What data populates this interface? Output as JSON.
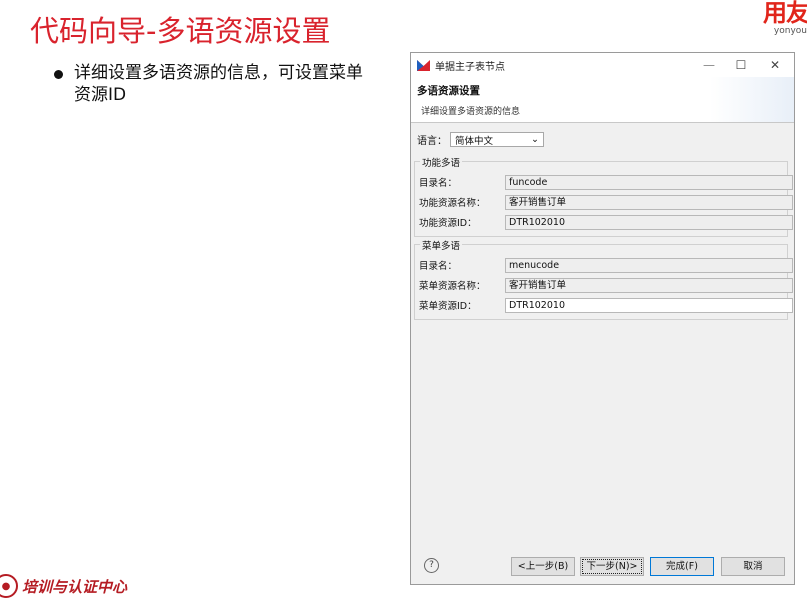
{
  "slide": {
    "title": "代码向导-多语资源设置",
    "bullet": "详细设置多语资源的信息，可设置菜单资源ID",
    "brand_main": "用友",
    "brand_sub": "yonyou",
    "footer_text": "培训与认证中心"
  },
  "dialog": {
    "window_title": "单据主子表节点",
    "banner_title": "多语资源设置",
    "banner_desc": "详细设置多语资源的信息",
    "language": {
      "label": "语言：",
      "selected": "简体中文"
    },
    "function_group": {
      "label": "功能多语",
      "fields": [
        {
          "label": "目录名：",
          "value": "funcode"
        },
        {
          "label": "功能资源名称：",
          "value": "客开销售订单"
        },
        {
          "label": "功能资源ID：",
          "value": "DTR102010"
        }
      ]
    },
    "menu_group": {
      "label": "菜单多语",
      "fields": [
        {
          "label": "目录名：",
          "value": "menucode"
        },
        {
          "label": "菜单资源名称：",
          "value": "客开销售订单"
        },
        {
          "label": "菜单资源ID：",
          "value": "DTR102010"
        }
      ]
    },
    "buttons": {
      "help": "?",
      "prev": "<上一步(B)",
      "next": "下一步(N)>",
      "finish": "完成(F)",
      "cancel": "取消"
    },
    "icons": {
      "minimize": "minimize-icon",
      "maximize": "maximize-icon",
      "close": "close-icon",
      "dropdown": "chevron-down-icon",
      "app": "app-icon"
    }
  }
}
